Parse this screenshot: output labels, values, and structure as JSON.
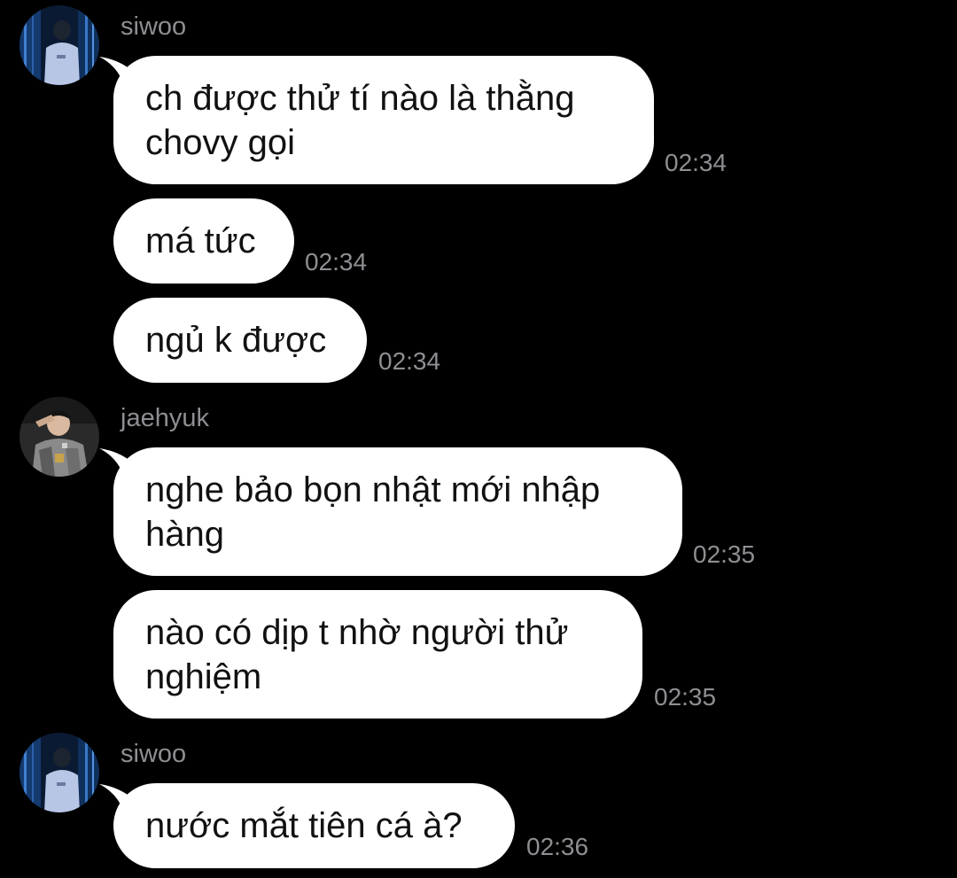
{
  "colors": {
    "background": "#000000",
    "bubble": "#ffffff",
    "bubble_text": "#111111",
    "meta_text": "#8e8e93"
  },
  "groups": [
    {
      "sender": "siwoo",
      "avatar_icon": "avatar-siwoo",
      "messages": [
        {
          "text": "ch được thử tí nào là thằng chovy gọi",
          "time": "02:34"
        },
        {
          "text": "má tức",
          "time": "02:34"
        },
        {
          "text": "ngủ k được",
          "time": "02:34"
        }
      ]
    },
    {
      "sender": "jaehyuk",
      "avatar_icon": "avatar-jaehyuk",
      "messages": [
        {
          "text": "nghe bảo bọn nhật mới nhập hàng",
          "time": "02:35"
        },
        {
          "text": "nào có dịp t nhờ người thử nghiệm",
          "time": "02:35"
        }
      ]
    },
    {
      "sender": "siwoo",
      "avatar_icon": "avatar-siwoo",
      "messages": [
        {
          "text": "nước mắt tiên cá à?",
          "time": "02:36"
        }
      ]
    }
  ]
}
